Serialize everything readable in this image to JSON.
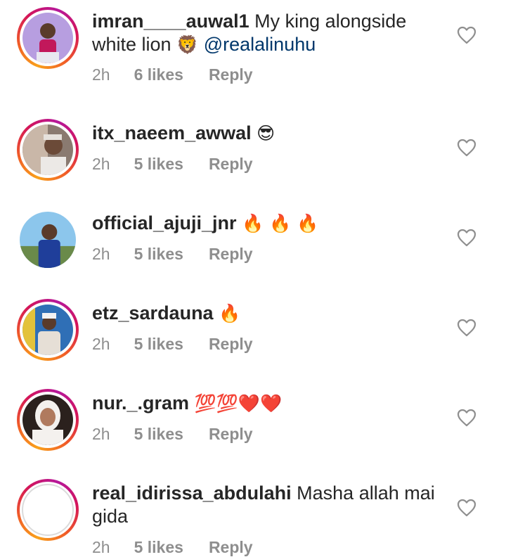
{
  "comments": [
    {
      "username": "imran____auwal1",
      "text": "My king alongside white lion",
      "emoji": "🦁",
      "mention": "@realalinuhu",
      "time": "2h",
      "likes": "6 likes",
      "reply": "Reply",
      "avatar_color": "#a98bd6"
    },
    {
      "username": "itx_naeem_awwal",
      "text": "",
      "emoji": "😎",
      "time": "2h",
      "likes": "5 likes",
      "reply": "Reply",
      "avatar_color": "#7a6a62"
    },
    {
      "username": "official_ajuji_jnr",
      "text": "",
      "emoji": "🔥 🔥 🔥",
      "time": "2h",
      "likes": "5 likes",
      "reply": "Reply",
      "avatar_color": "#5aa8d8"
    },
    {
      "username": "etz_sardauna",
      "text": "",
      "emoji": "🔥",
      "time": "2h",
      "likes": "5 likes",
      "reply": "Reply",
      "avatar_color": "#2e6fb0"
    },
    {
      "username": "nur._.gram",
      "text": "",
      "emoji": "💯💯❤️❤️",
      "time": "2h",
      "likes": "5 likes",
      "reply": "Reply",
      "avatar_color": "#3a2a25"
    },
    {
      "username": "real_idirissa_abdulahi",
      "text": "Masha allah mai gida",
      "emoji": "",
      "time": "2h",
      "likes": "5 likes",
      "reply": "Reply",
      "avatar_color": "#ffffff"
    }
  ],
  "icons": {
    "like": "heart-outline-icon"
  },
  "colors": {
    "text": "#262626",
    "meta": "#8e8e8e",
    "mention": "#00376b"
  }
}
